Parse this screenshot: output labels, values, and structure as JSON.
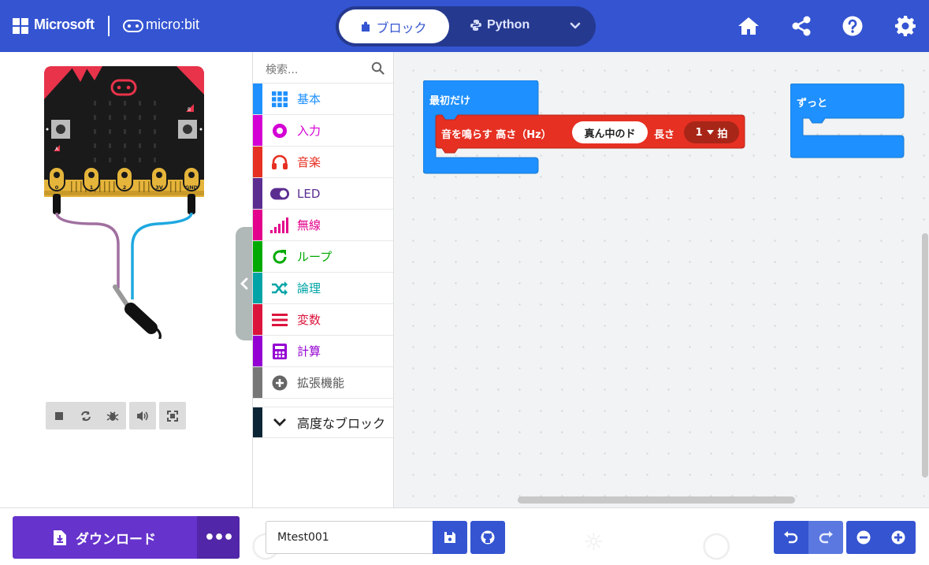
{
  "header": {
    "brand_microsoft": "Microsoft",
    "brand_microbit": "micro:bit",
    "mode_blocks": "ブロック",
    "mode_python": "Python",
    "icons": [
      "home-icon",
      "share-icon",
      "help-icon",
      "gear-icon"
    ]
  },
  "simulator": {
    "pins": [
      "0",
      "1",
      "2",
      "3V",
      "GND"
    ],
    "button_a": "A",
    "button_b": "B",
    "controls": [
      "stop-icon",
      "restart-icon",
      "debug-icon",
      "mute-icon",
      "fullscreen-icon"
    ]
  },
  "toolbox": {
    "search_placeholder": "検索...",
    "categories": [
      {
        "label": "基本",
        "color": "#1e90ff"
      },
      {
        "label": "入力",
        "color": "#d400d4"
      },
      {
        "label": "音楽",
        "color": "#e63022"
      },
      {
        "label": "LED",
        "color": "#5c2d91"
      },
      {
        "label": "無線",
        "color": "#e3008c"
      },
      {
        "label": "ループ",
        "color": "#00aa00"
      },
      {
        "label": "論理",
        "color": "#00a4a6"
      },
      {
        "label": "変数",
        "color": "#dc143c"
      },
      {
        "label": "計算",
        "color": "#9400d3"
      },
      {
        "label": "拡張機能",
        "color": "#777777"
      }
    ],
    "advanced": "高度なブロック"
  },
  "workspace": {
    "on_start": {
      "label": "最初だけ",
      "color": "#1e90ff"
    },
    "tone_block": {
      "prefix": "音を鳴らす 高さ（Hz）",
      "note": "真ん中のド",
      "length_label": "長さ",
      "beat_value": "1",
      "beat_unit": "拍",
      "color": "#e63022"
    },
    "forever": {
      "label": "ずっと",
      "color": "#1e90ff"
    }
  },
  "bottom": {
    "download_label": "ダウンロード",
    "more_label": "•••",
    "project_name": "Mtest001"
  }
}
